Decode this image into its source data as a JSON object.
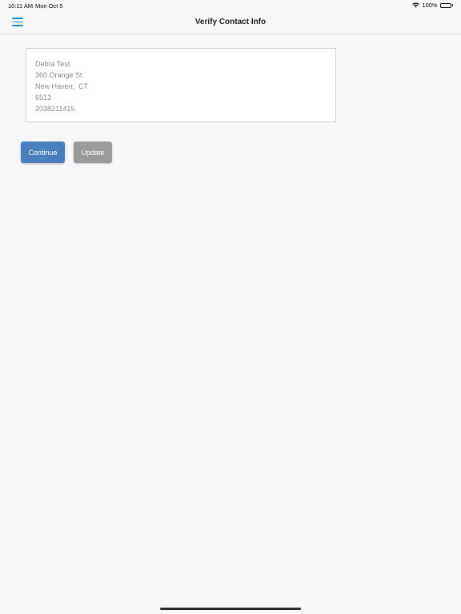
{
  "status_bar": {
    "time": "10:11 AM",
    "date": "Mon Oct 5",
    "battery": "100%",
    "battery_level": 1.0
  },
  "nav": {
    "title": "Verify Contact Info",
    "menu_icon": "hamburger-menu-icon"
  },
  "contact": {
    "name": "Debra Test",
    "street": "360 Orange St",
    "city_state": "New Haven,  CT",
    "zip": "6513",
    "phone": "2038211415"
  },
  "actions": {
    "continue_label": "Continue",
    "update_label": "Update"
  },
  "colors": {
    "accent": "#1e88e5",
    "continue_button": "#4a7fbf",
    "update_button": "#9a9a9a",
    "background": "#f7f7fa"
  }
}
